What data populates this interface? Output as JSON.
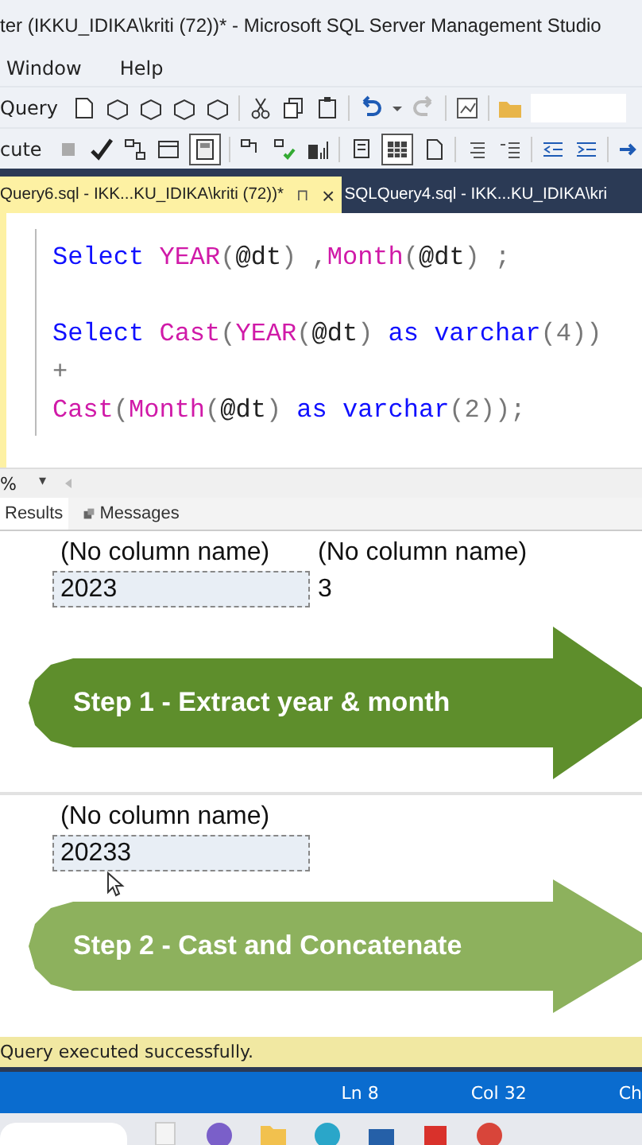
{
  "window": {
    "title": "ter (IKKU_IDIKA\\kriti (72))* - Microsoft SQL Server Management Studio"
  },
  "menu": [
    "Window",
    "Help"
  ],
  "toolbar": {
    "new_query": "Query",
    "execute": "cute"
  },
  "tabs": [
    {
      "label": "Query6.sql - IKK...KU_IDIKA\\kriti (72))*",
      "selected": true,
      "pin": "⊓",
      "close": "×"
    },
    {
      "label": "SQLQuery4.sql - IKK...KU_IDIKA\\kri",
      "selected": false
    }
  ],
  "editor": {
    "lines": [
      {
        "gap_before": false,
        "tokens": [
          {
            "kind": "kw",
            "t": "Select "
          },
          {
            "kind": "fn",
            "t": "YEAR"
          },
          {
            "kind": "op",
            "t": "("
          },
          {
            "kind": "id",
            "t": "@dt"
          },
          {
            "kind": "op",
            "t": ") ,"
          },
          {
            "kind": "fn",
            "t": "Month"
          },
          {
            "kind": "op",
            "t": "("
          },
          {
            "kind": "id",
            "t": "@dt"
          },
          {
            "kind": "op",
            "t": ") ;"
          }
        ]
      },
      {
        "gap_before": true,
        "tokens": [
          {
            "kind": "kw",
            "t": "Select "
          },
          {
            "kind": "fn",
            "t": "Cast"
          },
          {
            "kind": "op",
            "t": "("
          },
          {
            "kind": "fn",
            "t": "YEAR"
          },
          {
            "kind": "op",
            "t": "("
          },
          {
            "kind": "id",
            "t": "@dt"
          },
          {
            "kind": "op",
            "t": ") "
          },
          {
            "kind": "kw",
            "t": "as varchar"
          },
          {
            "kind": "op",
            "t": "(4))"
          }
        ]
      },
      {
        "gap_before": false,
        "tokens": [
          {
            "kind": "op",
            "t": "+"
          }
        ]
      },
      {
        "gap_before": false,
        "tokens": [
          {
            "kind": "fn",
            "t": "Cast"
          },
          {
            "kind": "op",
            "t": "("
          },
          {
            "kind": "fn",
            "t": "Month"
          },
          {
            "kind": "op",
            "t": "("
          },
          {
            "kind": "id",
            "t": "@dt"
          },
          {
            "kind": "op",
            "t": ") "
          },
          {
            "kind": "kw",
            "t": "as varchar"
          },
          {
            "kind": "op",
            "t": "(2));"
          }
        ]
      }
    ]
  },
  "zoom": {
    "value": "%",
    "caret": "▾"
  },
  "result_tabs": [
    {
      "label": "Results",
      "selected": true
    },
    {
      "label": "Messages",
      "selected": false
    }
  ],
  "grid1": {
    "columns": [
      "(No column name)",
      "(No column name)"
    ],
    "rows": [
      [
        {
          "t": "2023",
          "selected": true
        },
        {
          "t": "3",
          "selected": false
        }
      ]
    ]
  },
  "step1": {
    "label": "Step 1 - Extract year & month",
    "color": "#5e8e2c"
  },
  "grid2": {
    "columns": [
      "(No column name)"
    ],
    "rows": [
      [
        {
          "t": "20233",
          "selected": true
        }
      ]
    ]
  },
  "step2": {
    "label": "Step 2 - Cast and Concatenate",
    "color": "#8db15d"
  },
  "status_bar": {
    "message": "Query executed successfully.",
    "ln": "Ln 8",
    "col": "Col 32",
    "ch": "Ch"
  }
}
